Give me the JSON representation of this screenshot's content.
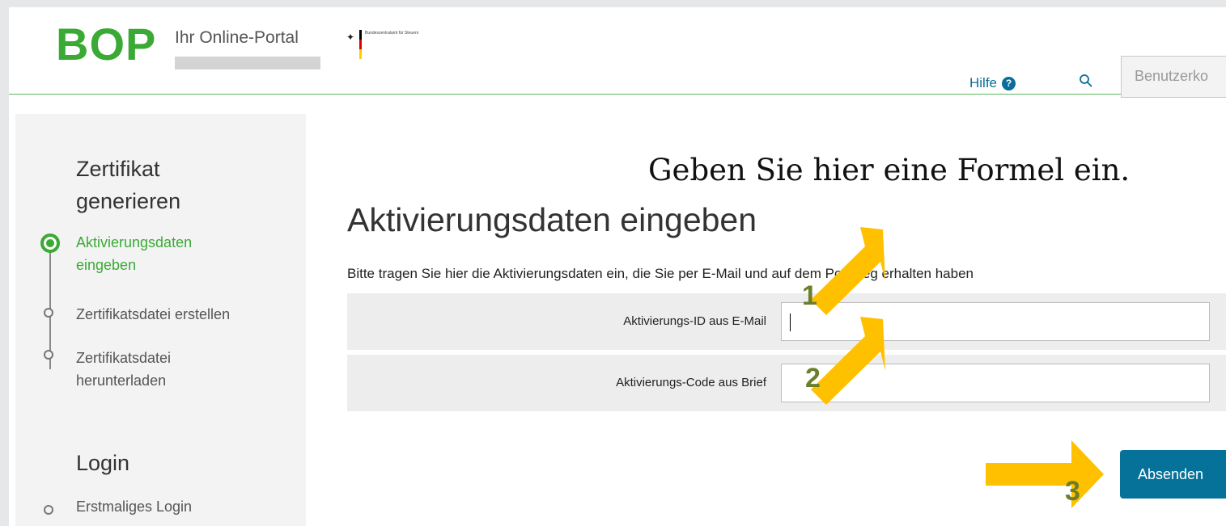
{
  "header": {
    "logo": "BOP",
    "logo_subtitle": "Ihr Online-Portal",
    "agency_text": "Bundeszentralamt für Steuern",
    "help_label": "Hilfe",
    "account_label": "Benutzerko"
  },
  "sidebar": {
    "section1_title": "Zertifikat generieren",
    "steps": [
      {
        "label": "Aktivierungsdaten eingeben",
        "active": true
      },
      {
        "label": "Zertifikatsdatei erstellen",
        "active": false
      },
      {
        "label": "Zertifikatsdatei herunterladen",
        "active": false
      }
    ],
    "section2_title": "Login",
    "login_steps": [
      {
        "label": "Erstmaliges Login"
      }
    ]
  },
  "main": {
    "formula_hint": "Geben Sie hier eine Formel ein.",
    "title": "Aktivierungsdaten eingeben",
    "intro": "Bitte tragen Sie hier die Aktivierungsdaten ein, die Sie per E-Mail und auf dem Postweg erhalten haben",
    "fields": [
      {
        "label": "Aktivierungs-ID aus E-Mail",
        "value": ""
      },
      {
        "label": "Aktivierungs-Code aus Brief",
        "value": ""
      }
    ],
    "submit_label": "Absenden"
  },
  "annotations": {
    "arrow_color": "#ffc000",
    "number_color": "#6b7f28",
    "labels": [
      "1",
      "2",
      "3"
    ]
  },
  "colors": {
    "brand_green": "#3aaa35",
    "link_blue": "#0a6e99",
    "button_blue": "#06729a"
  }
}
